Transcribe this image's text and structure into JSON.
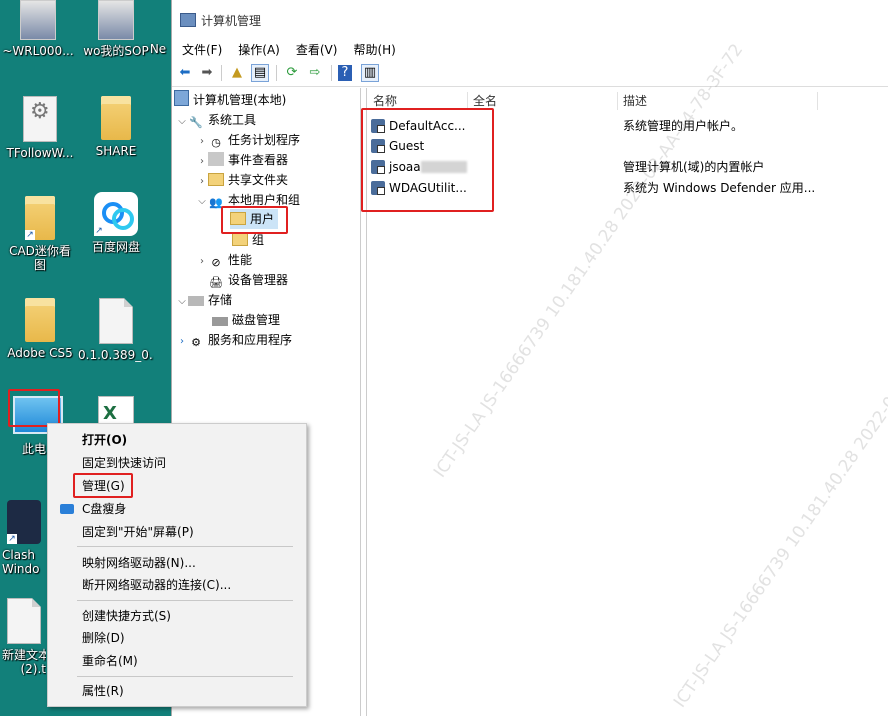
{
  "desktop": {
    "icons": [
      {
        "label": "~WRL000..."
      },
      {
        "label": "wo我的SOP"
      },
      {
        "label": "Ne"
      },
      {
        "label": "TFollowW..."
      },
      {
        "label": "SHARE"
      },
      {
        "label": "CAD迷你看"
      },
      {
        "label": "图"
      },
      {
        "label": "百度网盘"
      },
      {
        "label": "Adobe CS5"
      },
      {
        "label": "0.1.0.389_0..."
      },
      {
        "label": "此电"
      },
      {
        "label": "Clash"
      },
      {
        "label": "Windo"
      },
      {
        "label": "新建文本"
      },
      {
        "label": "(2).t"
      }
    ]
  },
  "window": {
    "title": "计算机管理",
    "menu": [
      "文件(F)",
      "操作(A)",
      "查看(V)",
      "帮助(H)"
    ],
    "toolbar_icons": [
      "back-arrow-icon",
      "forward-arrow-icon",
      "up-folder-icon",
      "show-hide-tree-icon",
      "refresh-icon",
      "export-list-icon",
      "help-icon",
      "show-hide-action-pane-icon"
    ]
  },
  "tree": {
    "root": "计算机管理(本地)",
    "system_tools": "系统工具",
    "task_scheduler": "任务计划程序",
    "event_viewer": "事件查看器",
    "shared_folders": "共享文件夹",
    "local_users_groups": "本地用户和组",
    "users": "用户",
    "groups": "组",
    "performance": "性能",
    "device_manager": "设备管理器",
    "storage": "存储",
    "disk_management": "磁盘管理",
    "services_apps": "服务和应用程序"
  },
  "list": {
    "columns": [
      "名称",
      "全名",
      "描述"
    ],
    "rows": [
      {
        "name": "DefaultAcc...",
        "full_name": "",
        "description": "系统管理的用户帐户。"
      },
      {
        "name": "Guest",
        "full_name": "",
        "description": ""
      },
      {
        "name": "jsoaa",
        "full_name": "",
        "description": "管理计算机(域)的内置帐户"
      },
      {
        "name": "WDAGUtilit...",
        "full_name": "",
        "description": "系统为 Windows Defender 应用..."
      }
    ]
  },
  "context_menu": {
    "items": [
      "打开(O)",
      "固定到快速访问",
      "管理(G)",
      "C盘瘦身",
      "固定到\"开始\"屏幕(P)",
      "映射网络驱动器(N)...",
      "断开网络驱动器的连接(C)...",
      "创建快捷方式(S)",
      "删除(D)",
      "重命名(M)",
      "属性(R)"
    ]
  },
  "watermark": "ICT-JS-LA JS-16666739 10.181.40.28 2022-02-AA-44-78-3F-72",
  "colors": {
    "desktop_bg": "#12807a",
    "highlight": "#e02020"
  }
}
